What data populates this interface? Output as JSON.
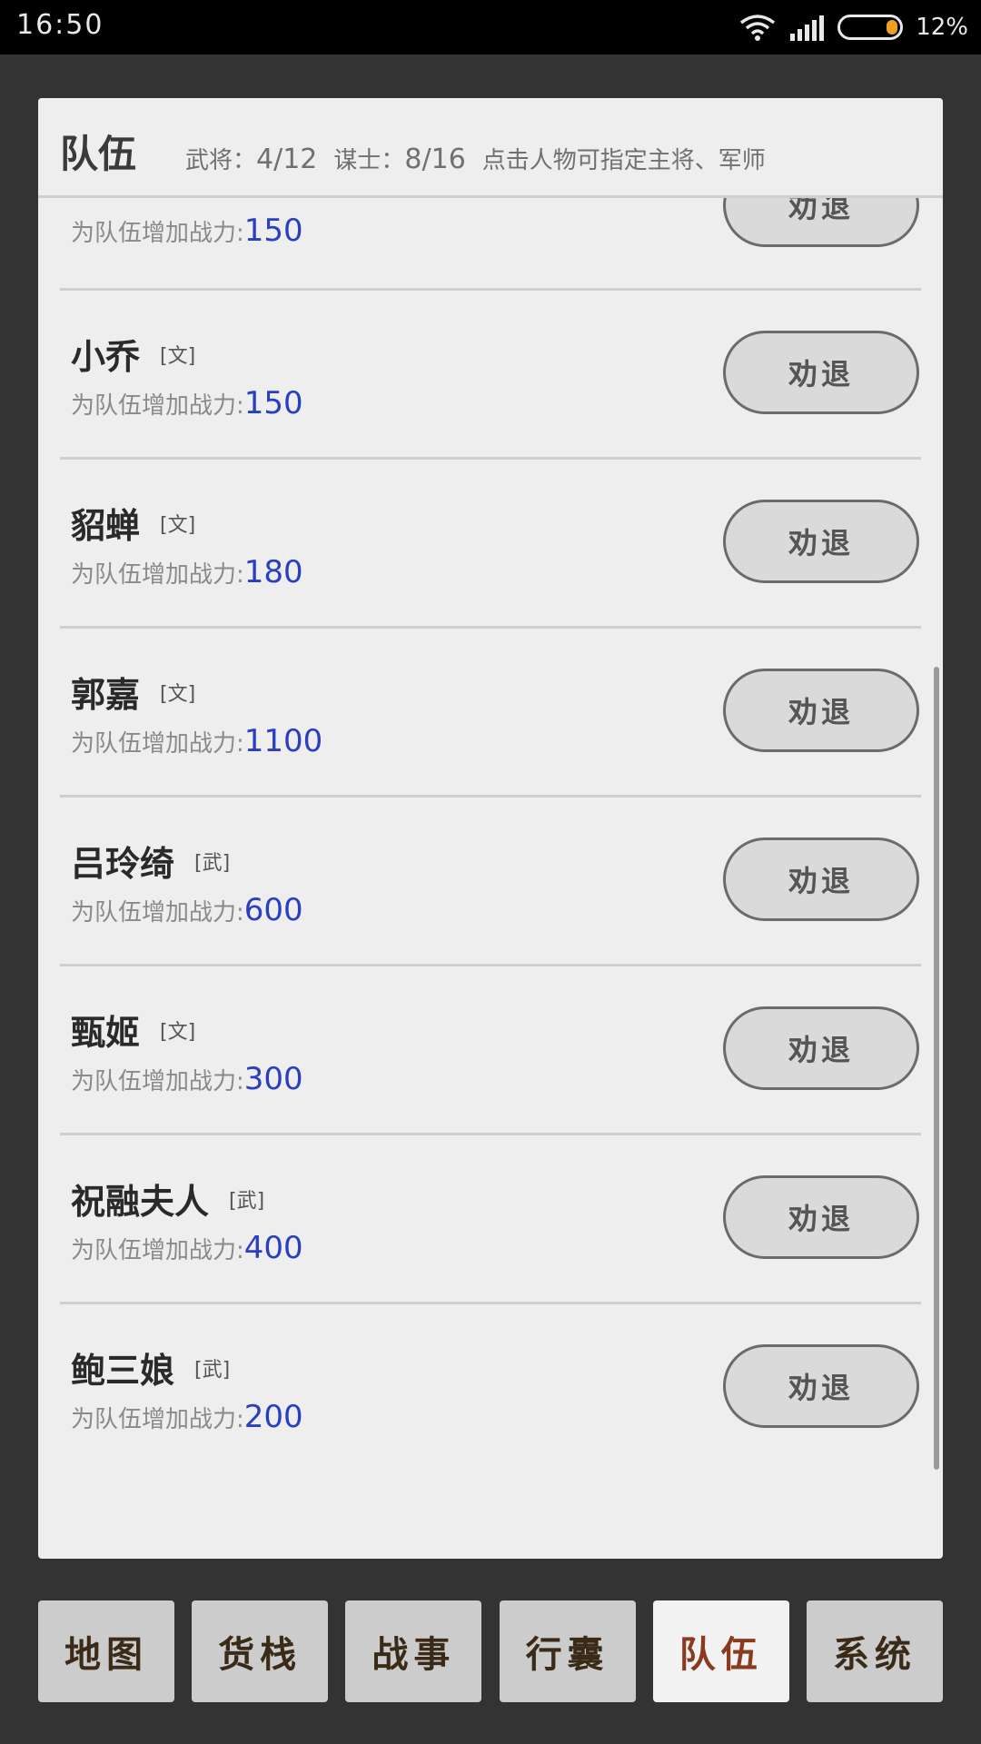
{
  "status": {
    "time": "16:50",
    "battery_percent": "12%",
    "battery_level": 0.12,
    "battery_color": "#f0a020"
  },
  "panel": {
    "title": "队伍",
    "generals_label": "武将：",
    "generals_value": "4/12",
    "advisors_label": "谋士：",
    "advisors_value": "8/16",
    "hint": "点击人物可指定主将、军师"
  },
  "roster": [
    {
      "name": "",
      "tag": "",
      "power_label": "为队伍增加战力:",
      "power": "150",
      "button": "劝退"
    },
    {
      "name": "小乔",
      "tag": "[文]",
      "power_label": "为队伍增加战力:",
      "power": "150",
      "button": "劝退"
    },
    {
      "name": "貂蝉",
      "tag": "[文]",
      "power_label": "为队伍增加战力:",
      "power": "180",
      "button": "劝退"
    },
    {
      "name": "郭嘉",
      "tag": "[文]",
      "power_label": "为队伍增加战力:",
      "power": "1100",
      "button": "劝退"
    },
    {
      "name": "吕玲绮",
      "tag": "[武]",
      "power_label": "为队伍增加战力:",
      "power": "600",
      "button": "劝退"
    },
    {
      "name": "甄姬",
      "tag": "[文]",
      "power_label": "为队伍增加战力:",
      "power": "300",
      "button": "劝退"
    },
    {
      "name": "祝融夫人",
      "tag": "[武]",
      "power_label": "为队伍增加战力:",
      "power": "400",
      "button": "劝退"
    },
    {
      "name": "鲍三娘",
      "tag": "[武]",
      "power_label": "为队伍增加战力:",
      "power": "200",
      "button": "劝退"
    }
  ],
  "nav": {
    "items": [
      "地图",
      "货栈",
      "战事",
      "行囊",
      "队伍",
      "系统"
    ],
    "active": "队伍"
  },
  "colors": {
    "power_value": "#2a3ec0",
    "nav_active_text": "#8a3a1e",
    "background": "#333333"
  }
}
